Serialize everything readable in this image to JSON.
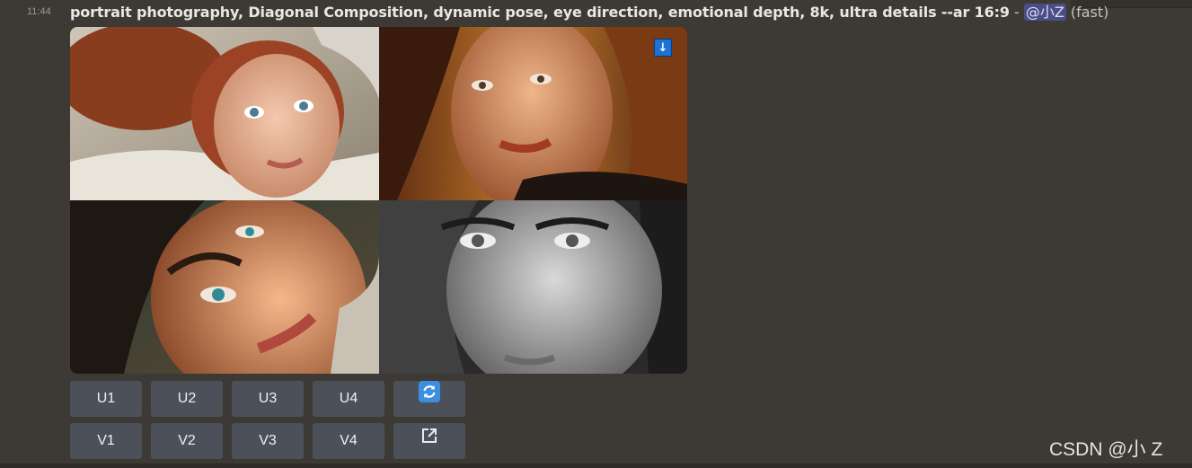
{
  "message": {
    "time": "11:44",
    "prompt": "portrait photography, Diagonal Composition, dynamic pose, eye direction, emotional depth, 8k, ultra details --ar 16:9",
    "separator": " - ",
    "mention": "@小Z",
    "speed": "(fast)"
  },
  "images": [
    {
      "name": "portrait-redhead-lying",
      "tone": "warm"
    },
    {
      "name": "portrait-golden-hair",
      "tone": "amber"
    },
    {
      "name": "portrait-freckles-closeup",
      "tone": "warm"
    },
    {
      "name": "portrait-black-and-white",
      "tone": "mono"
    }
  ],
  "download_icon": "↓",
  "buttons": {
    "row1": [
      {
        "label": "U1"
      },
      {
        "label": "U2"
      },
      {
        "label": "U3"
      },
      {
        "label": "U4"
      }
    ],
    "row2": [
      {
        "label": "V1"
      },
      {
        "label": "V2"
      },
      {
        "label": "V3"
      },
      {
        "label": "V4"
      }
    ],
    "reroll_icon": "refresh-icon",
    "open_icon": "external-link-icon"
  },
  "colors": {
    "background": "#3d3935",
    "button": "#4c5058",
    "mention_bg": "#4b4e82",
    "accent": "#1b73d6"
  },
  "watermark": "CSDN @小 Z"
}
